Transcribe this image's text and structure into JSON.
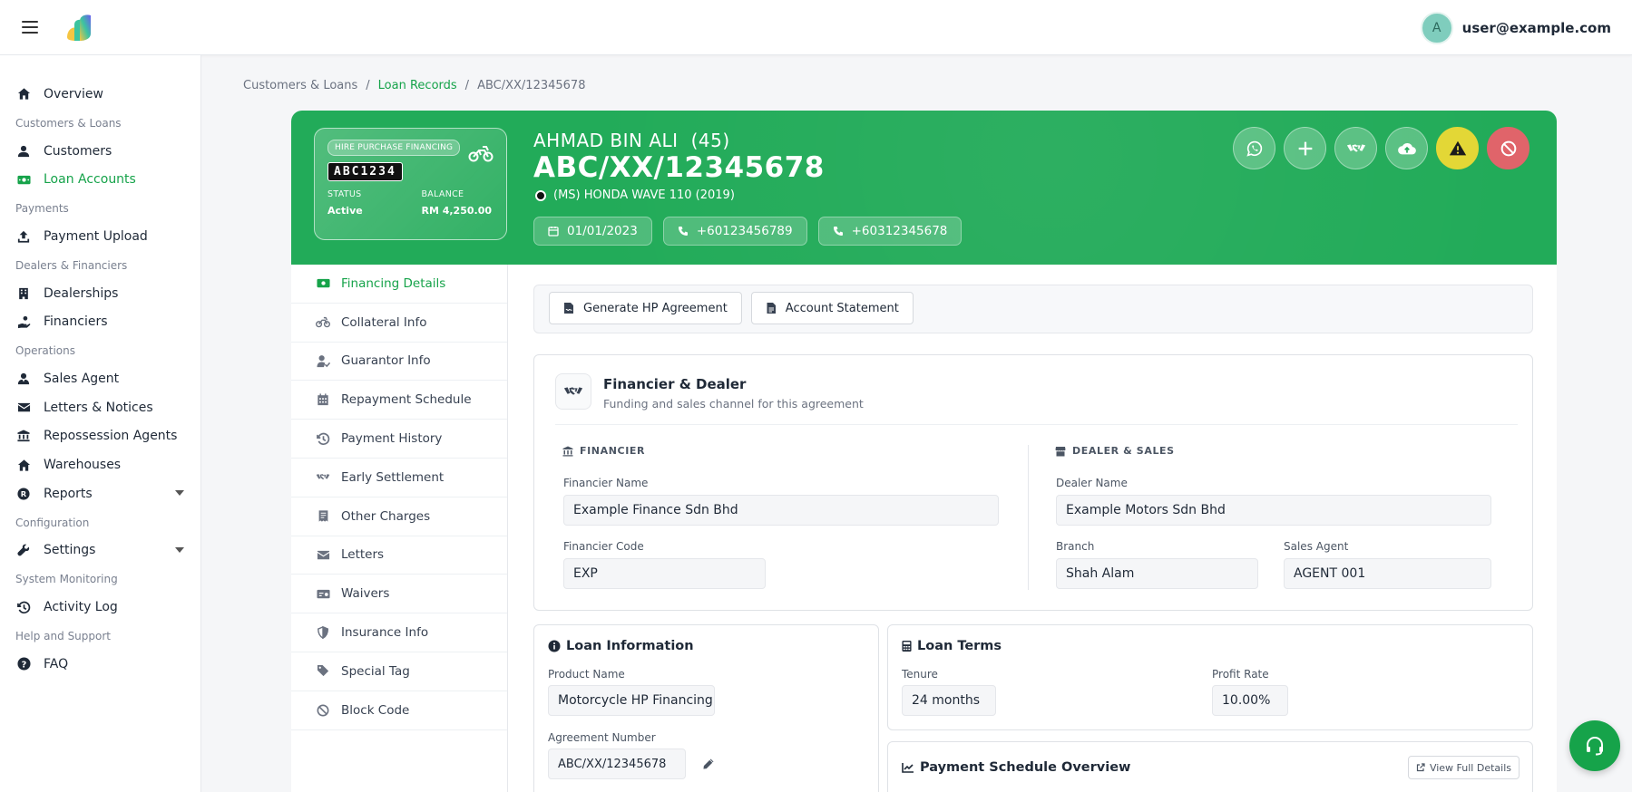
{
  "header": {
    "avatar_initial": "A",
    "user_email": "user@example.com"
  },
  "sidebar": {
    "items": [
      {
        "label": "Overview",
        "icon": "home-icon"
      },
      {
        "section": "Customers & Loans"
      },
      {
        "label": "Customers",
        "icon": "user-icon"
      },
      {
        "label": "Loan Accounts",
        "icon": "money-icon",
        "active": true
      },
      {
        "section": "Payments"
      },
      {
        "label": "Payment Upload",
        "icon": "upload-icon"
      },
      {
        "section": "Dealers & Financiers"
      },
      {
        "label": "Dealerships",
        "icon": "building-icon"
      },
      {
        "label": "Financiers",
        "icon": "hand-coin-icon"
      },
      {
        "section": "Operations"
      },
      {
        "label": "Sales Agent",
        "icon": "user-tie-icon"
      },
      {
        "label": "Letters & Notices",
        "icon": "envelope-icon"
      },
      {
        "label": "Repossession Agents",
        "icon": "bank-icon"
      },
      {
        "label": "Warehouses",
        "icon": "warehouse-icon"
      },
      {
        "label": "Reports",
        "icon": "reports-icon",
        "expandable": true
      },
      {
        "section": "Configuration"
      },
      {
        "label": "Settings",
        "icon": "wrench-icon",
        "expandable": true
      },
      {
        "section": "System Monitoring"
      },
      {
        "label": "Activity Log",
        "icon": "history-icon"
      },
      {
        "section": "Help and Support"
      },
      {
        "label": "FAQ",
        "icon": "question-icon"
      }
    ]
  },
  "breadcrumb": {
    "root": "Customers & Loans",
    "sep": "/",
    "middle": "Loan Records",
    "current": "ABC/XX/12345678"
  },
  "hero": {
    "card_badge": "HIRE PURCHASE FINANCING",
    "plate": "ABC1234",
    "status_label": "STATUS",
    "status_value": "Active",
    "balance_label": "BALANCE",
    "balance_value": "RM 4,250.00",
    "customer_name": "AHMAD BIN ALI",
    "age": "(45)",
    "agreement_no": "ABC/XX/12345678",
    "vehicle": "(MS) HONDA WAVE 110 (2019)",
    "chips": [
      "01/01/2023",
      "+60123456789",
      "+60312345678"
    ],
    "accent": "#22ab59"
  },
  "tabs": [
    {
      "label": "Financing Details",
      "icon": "money-bill-icon",
      "active": true
    },
    {
      "label": "Collateral Info",
      "icon": "motorcycle-icon"
    },
    {
      "label": "Guarantor Info",
      "icon": "user-check-icon"
    },
    {
      "label": "Repayment Schedule",
      "icon": "calendar-icon"
    },
    {
      "label": "Payment History",
      "icon": "history-icon"
    },
    {
      "label": "Early Settlement",
      "icon": "handshake-icon"
    },
    {
      "label": "Other Charges",
      "icon": "receipt-icon"
    },
    {
      "label": "Letters",
      "icon": "envelope-icon"
    },
    {
      "label": "Waivers",
      "icon": "money-check-icon"
    },
    {
      "label": "Insurance Info",
      "icon": "shield-icon"
    },
    {
      "label": "Special Tag",
      "icon": "tags-icon"
    },
    {
      "label": "Block Code",
      "icon": "ban-icon"
    }
  ],
  "actions": {
    "generate": "Generate HP Agreement",
    "statement": "Account Statement"
  },
  "financier_dealer": {
    "title": "Financier & Dealer",
    "subtitle": "Funding and sales channel for this agreement",
    "financier_section": "FINANCIER",
    "financier_name_label": "Financier Name",
    "financier_name": "Example Finance Sdn Bhd",
    "financier_code_label": "Financier Code",
    "financier_code": "EXP",
    "dealer_section": "DEALER & SALES",
    "dealer_name_label": "Dealer Name",
    "dealer_name": "Example Motors Sdn Bhd",
    "branch_label": "Branch",
    "branch": "Shah Alam",
    "sales_agent_label": "Sales Agent",
    "sales_agent": "AGENT 001"
  },
  "loan_info": {
    "title": "Loan Information",
    "product_label": "Product Name",
    "product": "Motorcycle HP Financing",
    "agreement_label": "Agreement Number",
    "agreement": "ABC/XX/12345678"
  },
  "loan_terms": {
    "title": "Loan Terms",
    "tenure_label": "Tenure",
    "tenure": "24 months",
    "rate_label": "Profit Rate",
    "rate": "10.00%"
  },
  "schedule_overview": {
    "title": "Payment Schedule Overview",
    "view_full": "View Full Details"
  }
}
